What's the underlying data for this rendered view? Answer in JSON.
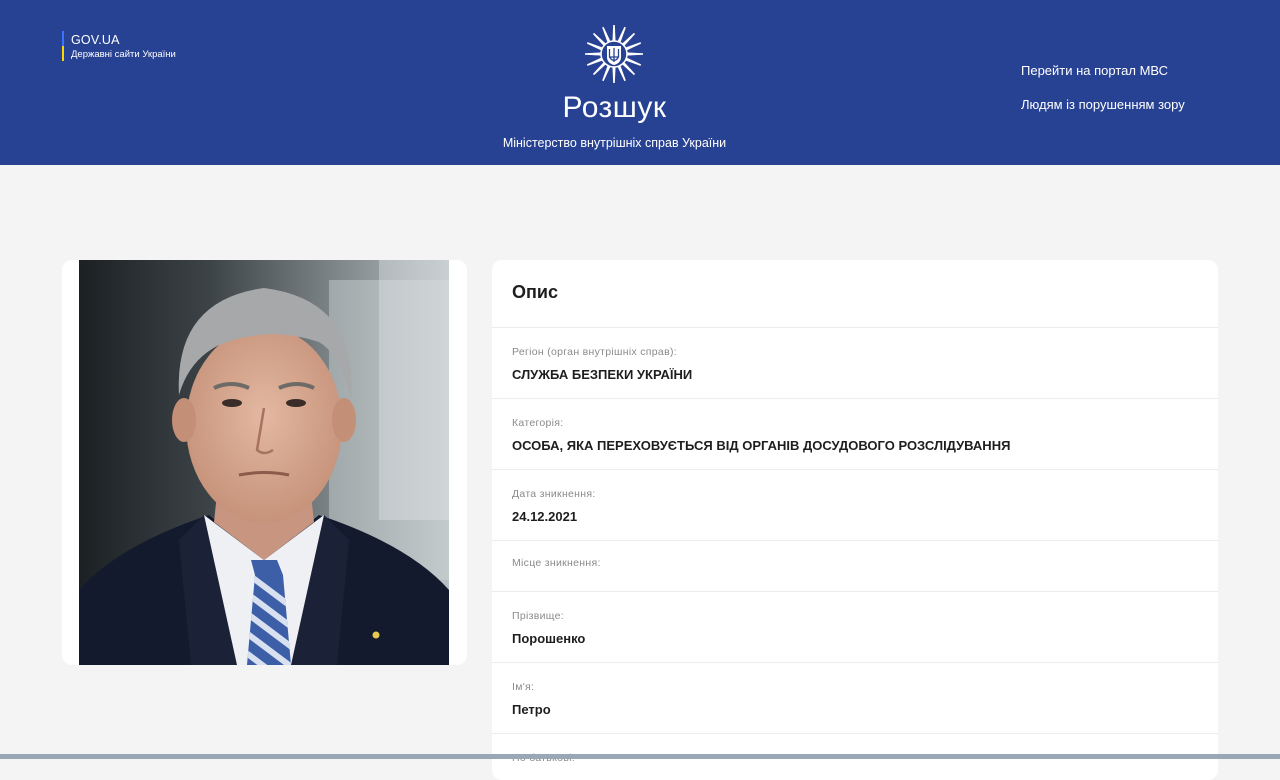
{
  "header": {
    "gov_name": "GOV.UA",
    "gov_sub": "Державні сайти України",
    "title": "Розшук",
    "subtitle": "Міністерство внутрішніх справ України",
    "links": [
      {
        "label": "Перейти на портал МВС"
      },
      {
        "label": "Людям із порушенням зору"
      }
    ]
  },
  "card": {
    "title": "Опис",
    "fields": [
      {
        "label": "Регіон (орган внутрішніх справ):",
        "value": "СЛУЖБА БЕЗПЕКИ УКРАЇНИ"
      },
      {
        "label": "Категорія:",
        "value": "ОСОБА, ЯКА ПЕРЕХОВУЄТЬСЯ ВІД ОРГАНІВ ДОСУДОВОГО РОЗСЛІДУВАННЯ"
      },
      {
        "label": "Дата зникнення:",
        "value": "24.12.2021"
      },
      {
        "label": "Місце зникнення:",
        "value": ""
      },
      {
        "label": "Прізвище:",
        "value": "Порошенко"
      },
      {
        "label": "Ім'я:",
        "value": "Петро"
      },
      {
        "label": "По батькові:",
        "value": ""
      }
    ]
  },
  "colors": {
    "header_bg": "#284293",
    "page_bg": "#f4f4f4",
    "card_bg": "#ffffff",
    "label_text": "#8a8a8a",
    "value_text": "#1e1e1e"
  }
}
